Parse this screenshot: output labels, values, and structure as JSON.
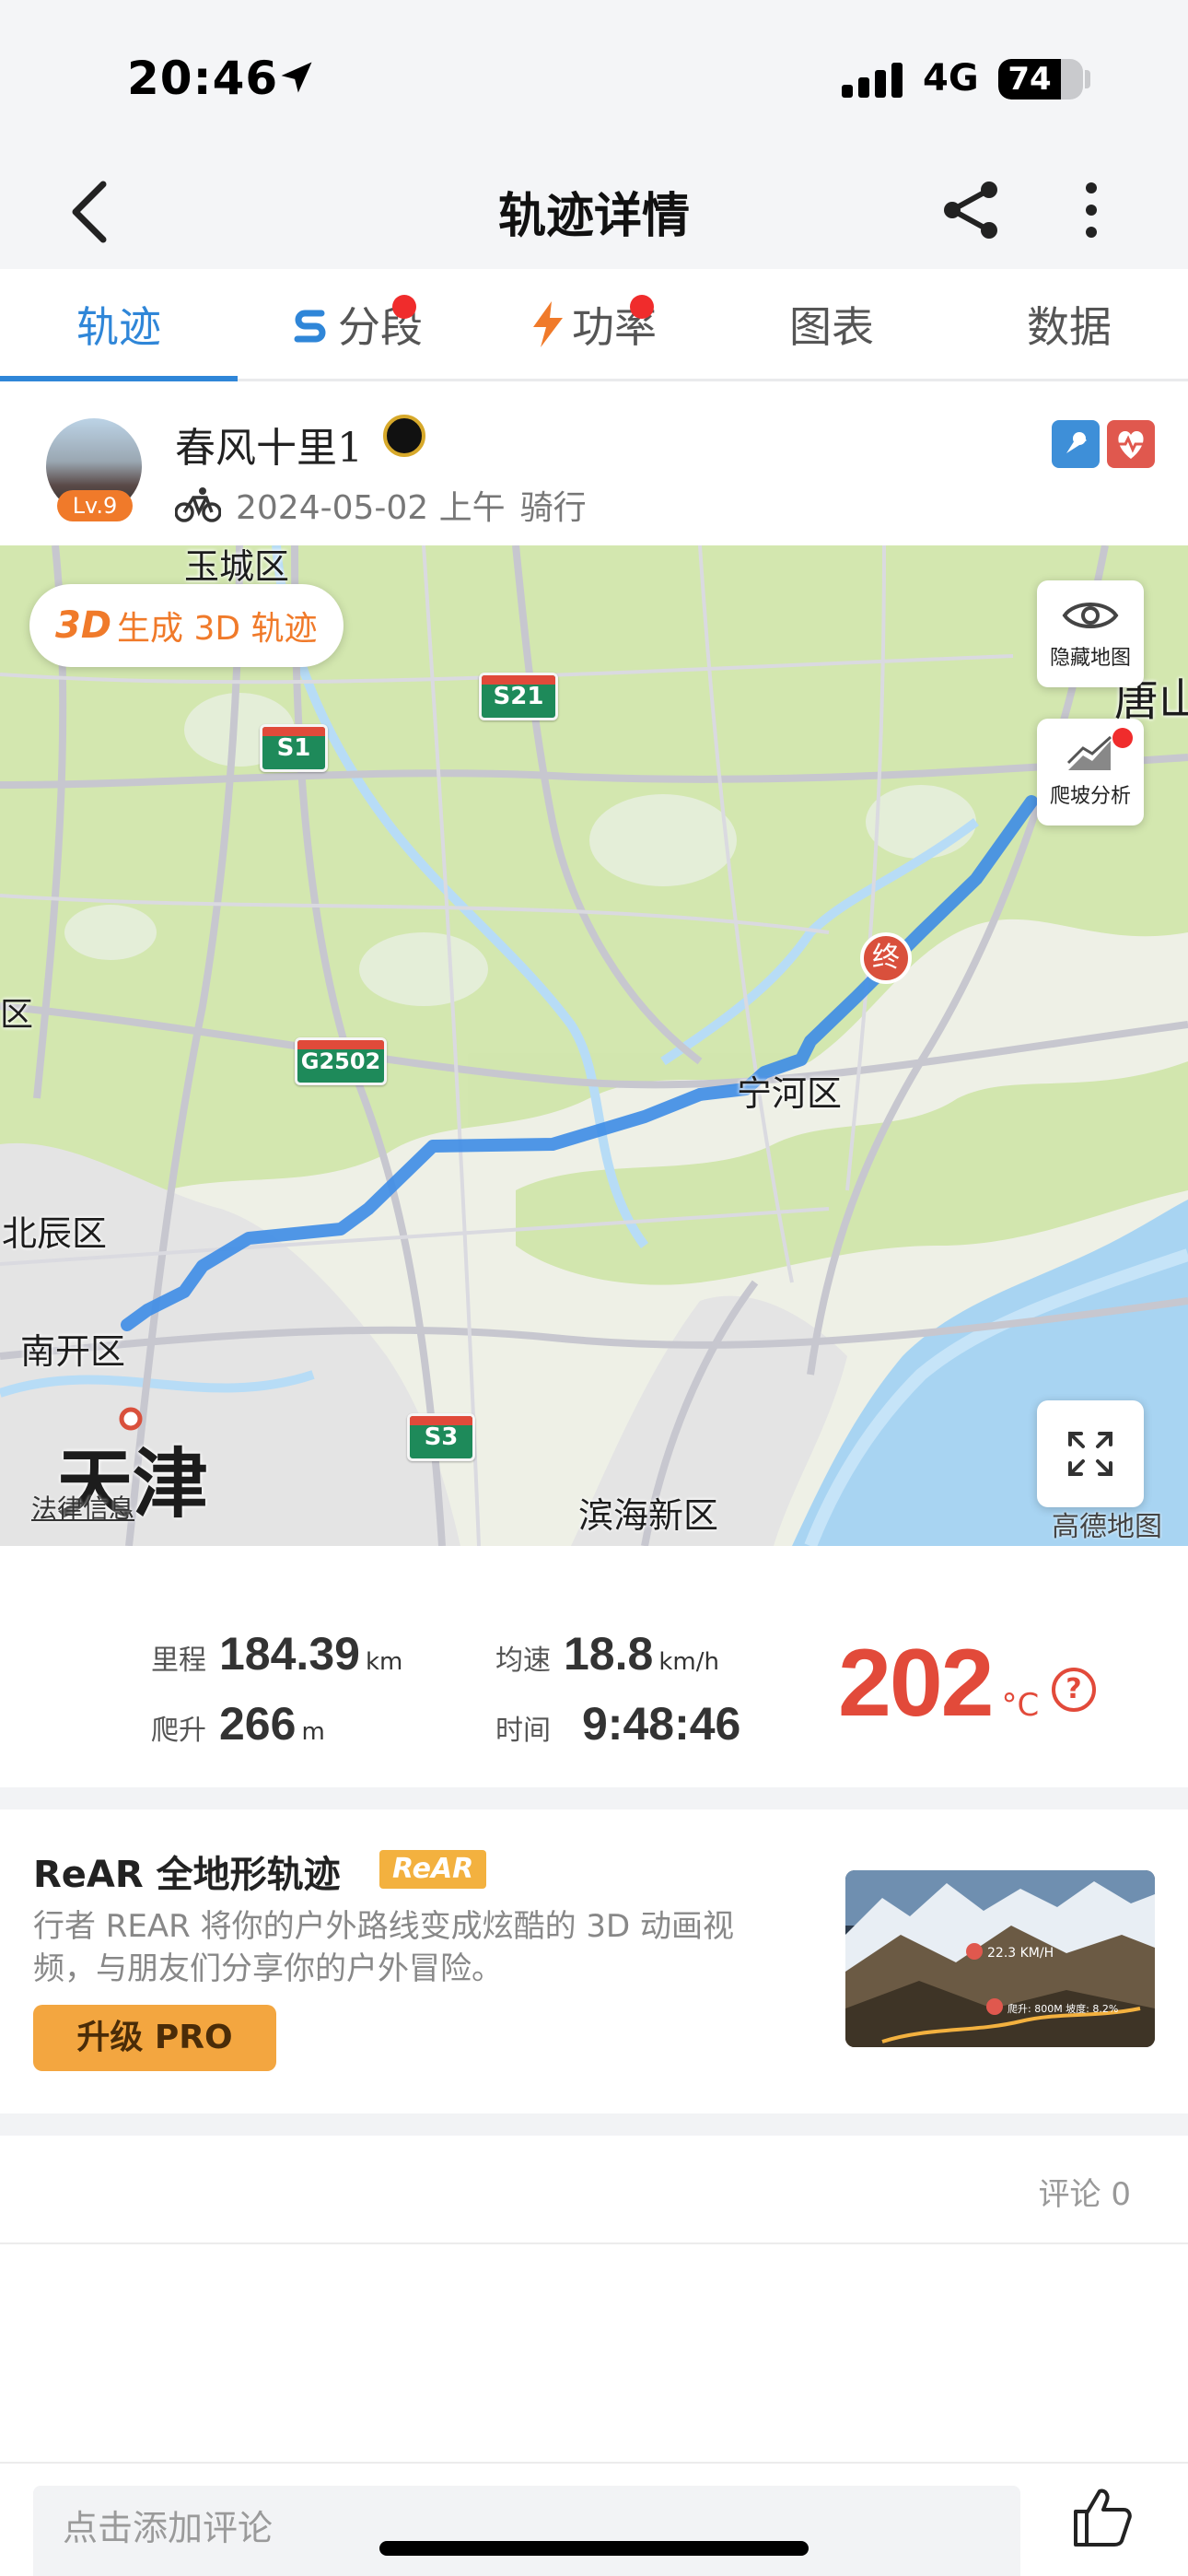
{
  "status_bar": {
    "time": "20:46",
    "network": "4G",
    "battery": "74",
    "battery_level": 0.74
  },
  "nav": {
    "title": "轨迹详情",
    "back_icon": "chevron-left-icon",
    "share_icon": "share-icon",
    "more_icon": "more-vertical-icon"
  },
  "tabs": [
    {
      "label": "轨迹",
      "active": true
    },
    {
      "label": "分段",
      "icon": "segment-icon",
      "dot": true
    },
    {
      "label": "功率",
      "icon": "lightning-icon",
      "dot": true
    },
    {
      "label": "图表"
    },
    {
      "label": "数据"
    }
  ],
  "profile": {
    "name": "春风十里1",
    "level": "Lv.9",
    "date": "2024-05-02 上午",
    "activity": "骑行"
  },
  "map": {
    "btn_3d_prefix": "3D",
    "btn_3d_label": "生成 3D 轨迹",
    "hide_map": "隐藏地图",
    "climb_analysis": "爬坡分析",
    "end_marker": "终",
    "labels": {
      "yucheng": "玉城区",
      "tangshan": "唐山",
      "ninghe": "宁河区",
      "beichen": "北辰区",
      "nankai": "南开区",
      "tianjin": "天津",
      "binhai": "滨海新区",
      "district": "区"
    },
    "shields": {
      "s21": "S21",
      "s1": "S1",
      "g2502": "G2502",
      "s3": "S3"
    },
    "legal": "法律信息",
    "provider": "高德地图"
  },
  "stats": {
    "distance_label": "里程",
    "distance": "184.39",
    "distance_unit": "km",
    "climb_label": "爬升",
    "climb": "266",
    "climb_unit": "m",
    "speed_label": "均速",
    "speed": "18.8",
    "speed_unit": "km/h",
    "time_label": "时间",
    "time": "9:48:46",
    "calories": "202",
    "calories_unit": "°C"
  },
  "promo": {
    "title": "ReAR 全地形轨迹",
    "tag": "ReAR",
    "description": "行者 REAR 将你的户外路线变成炫酷的 3D 动画视频，与朋友们分享你的户外冒险。",
    "button": "升级 PRO",
    "thumb_speed": "22.3 KM/H",
    "thumb_stats": "爬升: 800M  坡度: 8.2%"
  },
  "comments": {
    "count_label": "评论 0"
  },
  "bottom": {
    "placeholder": "点击添加评论",
    "like_icon": "thumbs-up-icon"
  },
  "colors": {
    "accent": "#2f86d8",
    "route": "#3d8ce6",
    "calorie": "#e24a3a",
    "promo": "#f3a640"
  }
}
